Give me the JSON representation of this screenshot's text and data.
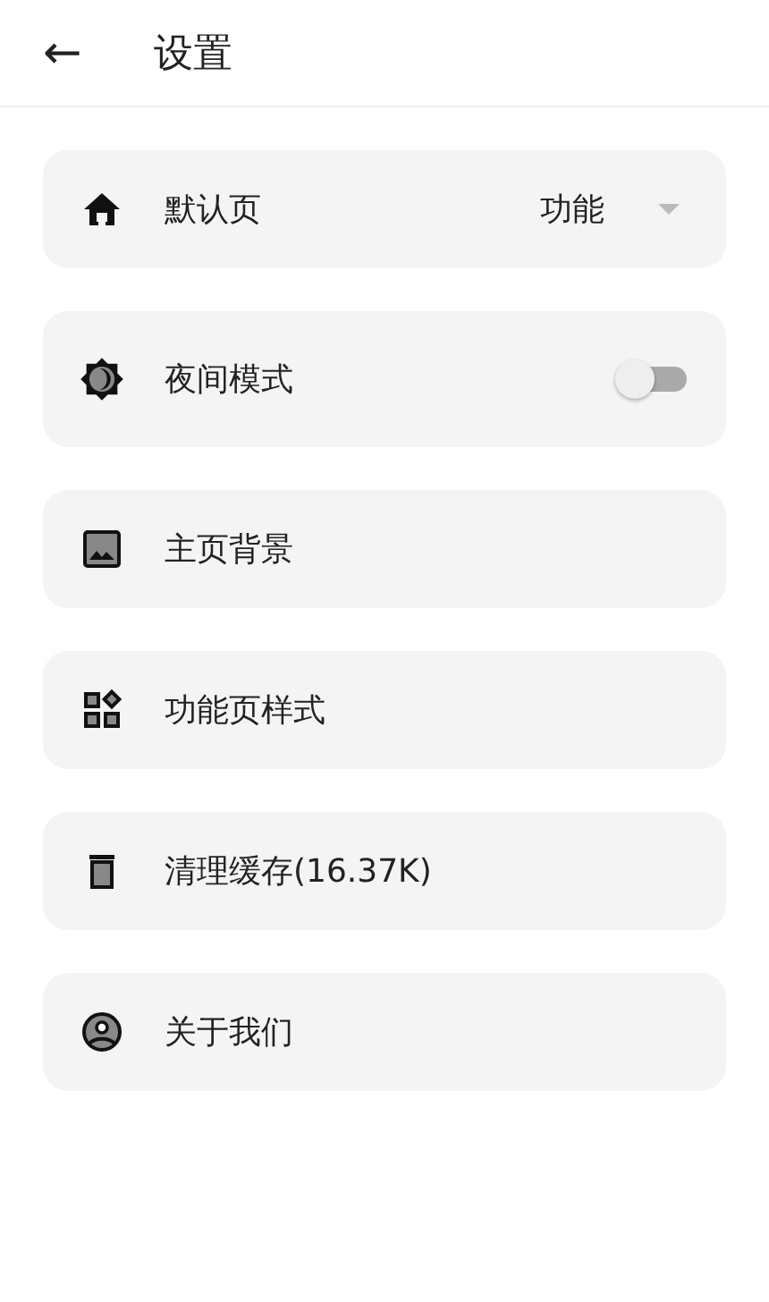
{
  "header": {
    "back": "←",
    "title": "设置"
  },
  "items": [
    {
      "kind": "dropdown",
      "label": "默认页",
      "value": "功能"
    },
    {
      "kind": "toggle",
      "label": "夜间模式",
      "on": false
    },
    {
      "kind": "plain",
      "label": "主页背景"
    },
    {
      "kind": "plain",
      "label": "功能页样式"
    },
    {
      "kind": "plain",
      "label": "清理缓存(16.37K)"
    },
    {
      "kind": "plain",
      "label": "关于我们"
    }
  ]
}
